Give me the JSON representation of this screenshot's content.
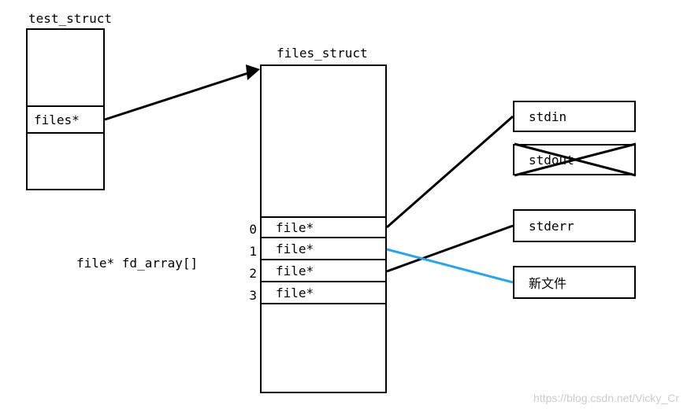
{
  "test_struct": {
    "title": "test_struct",
    "field": "files*"
  },
  "files_struct": {
    "title": "files_struct",
    "array_label": "file* fd_array[]",
    "indices": [
      "0",
      "1",
      "2",
      "3"
    ],
    "entries": [
      "file*",
      "file*",
      "file*",
      "file*"
    ]
  },
  "file_boxes": {
    "stdin": "stdin",
    "stdout": "stdout",
    "stderr": "stderr",
    "newfile": "新文件"
  },
  "watermark": "https://blog.csdn.net/Vicky_Cr",
  "colors": {
    "blue": "#2aa4e8"
  }
}
